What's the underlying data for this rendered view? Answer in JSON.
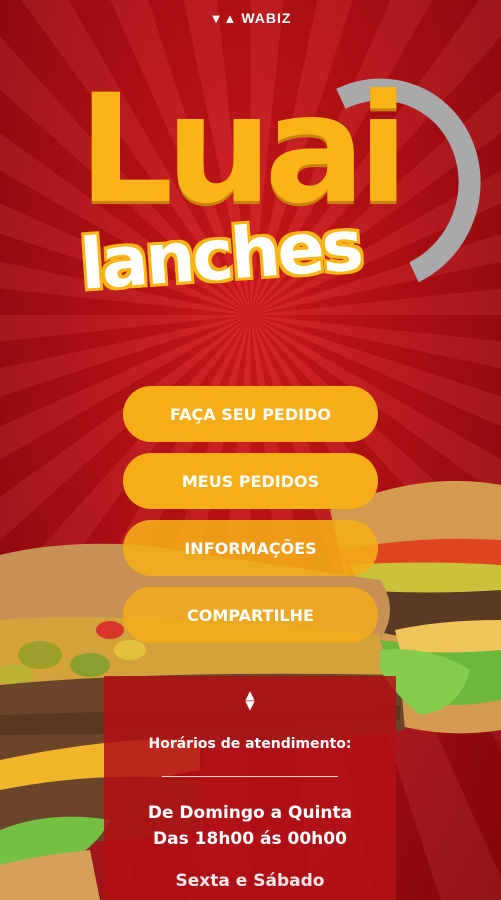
{
  "brand": {
    "name": "WABIZ"
  },
  "logo": {
    "word_top": "Luai",
    "word_bottom": "lanches"
  },
  "menu": {
    "order_label": "FAÇA SEU PEDIDO",
    "my_orders_label": "MEUS PEDIDOS",
    "info_label": "INFORMAÇÕES",
    "share_label": "COMPARTILHE"
  },
  "hours": {
    "title": "Horários de atendimento:",
    "days": "De Domingo a Quinta",
    "time": "Das 18h00 ás 00h00",
    "next_line": "Sexta e Sábado"
  },
  "colors": {
    "background": "#b30f14",
    "accent": "#f5ae18",
    "panel": "#b21016",
    "logo_moon": "#a9a9a9"
  }
}
